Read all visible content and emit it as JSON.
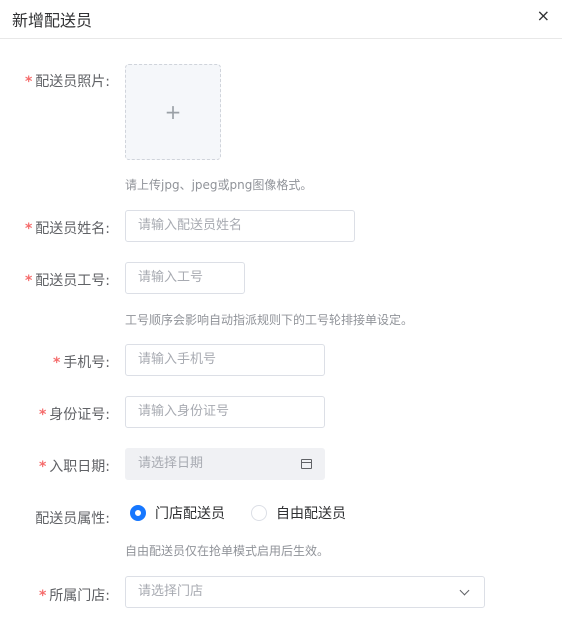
{
  "dialog": {
    "title": "新增配送员",
    "close_glyph": "×"
  },
  "form": {
    "photo": {
      "label": "配送员照片:",
      "required": true,
      "plus": "+",
      "hint": "请上传jpg、jpeg或png图像格式。"
    },
    "name": {
      "label": "配送员姓名:",
      "required": true,
      "placeholder": "请输入配送员姓名"
    },
    "worknum": {
      "label": "配送员工号:",
      "required": true,
      "placeholder": "请输入工号",
      "hint": "工号顺序会影响自动指派规则下的工号轮排接单设定。"
    },
    "phone": {
      "label": "手机号:",
      "required": true,
      "placeholder": "请输入手机号"
    },
    "idcard": {
      "label": "身份证号:",
      "required": true,
      "placeholder": "请输入身份证号"
    },
    "entry_date": {
      "label": "入职日期:",
      "required": true,
      "placeholder": "请选择日期",
      "icon": "calendar-icon"
    },
    "attribute": {
      "label": "配送员属性:",
      "required": false,
      "options": [
        {
          "label": "门店配送员",
          "checked": true
        },
        {
          "label": "自由配送员",
          "checked": false
        }
      ],
      "hint": "自由配送员仅在抢单模式启用后生效。"
    },
    "store": {
      "label": "所属门店:",
      "required": true,
      "placeholder": "请选择门店",
      "icon": "chevron-down-icon"
    }
  },
  "colors": {
    "required": "#f56c6c",
    "accent": "#1677ff",
    "hint": "#909399"
  }
}
